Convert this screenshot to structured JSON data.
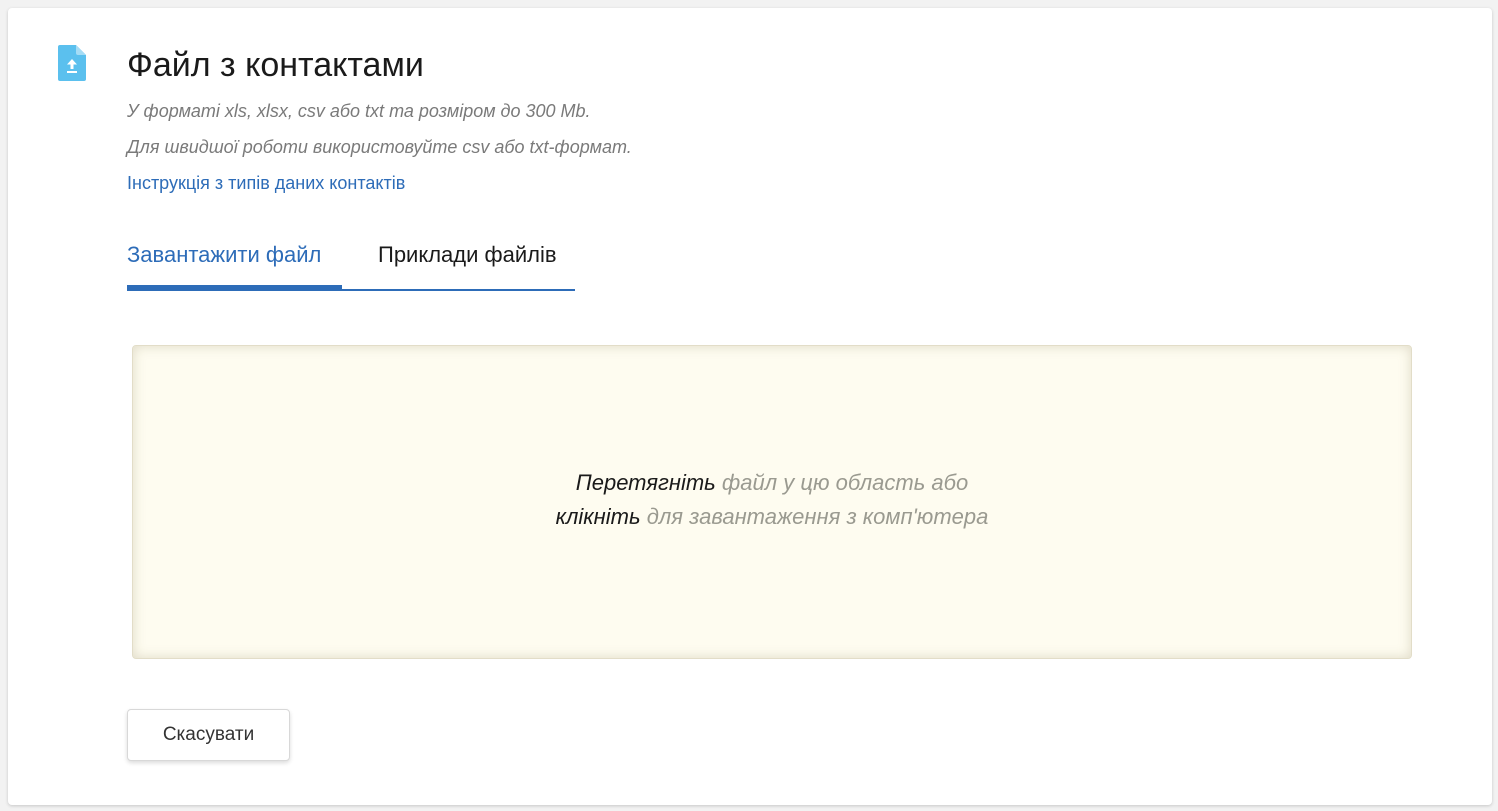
{
  "header": {
    "title": "Файл з контактами",
    "icon": "file-upload-icon",
    "icon_color": "#5bc0ee"
  },
  "hints": {
    "format": "У форматі xls, xlsx, csv або txt та розміром до 300 Mb.",
    "speed": "Для швидшої роботи використовуйте csv або txt-формат."
  },
  "links": {
    "instruction": "Інструкція з типів даних контактів"
  },
  "tabs": [
    {
      "label": "Завантажити файл",
      "active": true
    },
    {
      "label": "Приклади файлів",
      "active": false
    }
  ],
  "dropzone": {
    "drag_word": "Перетягніть",
    "drag_rest": " файл у цю область або",
    "click_word": "клікніть",
    "click_rest": " для завантаження з комп'ютера"
  },
  "actions": {
    "cancel_label": "Скасувати"
  },
  "colors": {
    "accent": "#2d6cb8",
    "dropzone_bg": "#fefcf0"
  }
}
